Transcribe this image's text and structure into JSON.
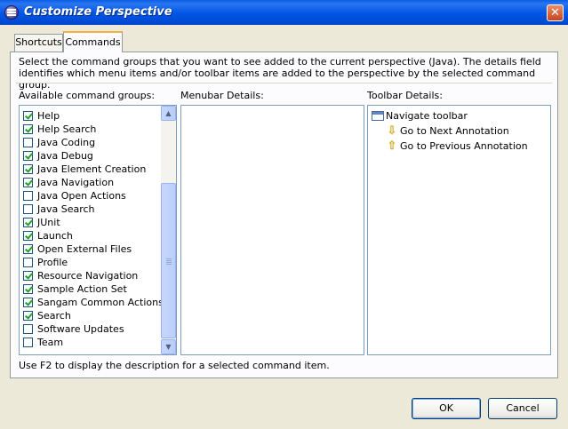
{
  "window": {
    "title": "Customize Perspective",
    "close_glyph": "✕",
    "icon": "eclipse-icon"
  },
  "tabs": [
    {
      "label": "Shortcuts"
    },
    {
      "label": "Commands"
    }
  ],
  "description": "Select the command groups that you want to see added to the current perspective (Java).  The details field identifies which menu items and/or toolbar items are added to the perspective by the selected command group.",
  "labels": {
    "available": "Available command groups:",
    "menubar": "Menubar Details:",
    "toolbar": "Toolbar Details:"
  },
  "command_groups": [
    {
      "label": "Help",
      "checked": true
    },
    {
      "label": "Help Search",
      "checked": true
    },
    {
      "label": "Java Coding",
      "checked": false
    },
    {
      "label": "Java Debug",
      "checked": true
    },
    {
      "label": "Java Element Creation",
      "checked": true
    },
    {
      "label": "Java Navigation",
      "checked": true
    },
    {
      "label": "Java Open Actions",
      "checked": false
    },
    {
      "label": "Java Search",
      "checked": false
    },
    {
      "label": "JUnit",
      "checked": true
    },
    {
      "label": "Launch",
      "checked": true
    },
    {
      "label": "Open External Files",
      "checked": true
    },
    {
      "label": "Profile",
      "checked": false
    },
    {
      "label": "Resource Navigation",
      "checked": true
    },
    {
      "label": "Sample Action Set",
      "checked": true
    },
    {
      "label": "Sangam Common Actions",
      "checked": true
    },
    {
      "label": "Search",
      "checked": true
    },
    {
      "label": "Software Updates",
      "checked": false
    },
    {
      "label": "Team",
      "checked": false
    }
  ],
  "toolbar_details": {
    "root": "Navigate toolbar",
    "children": [
      {
        "label": "Go to Next Annotation",
        "icon": "arrow-down-icon",
        "glyph": "⇩"
      },
      {
        "label": "Go to Previous Annotation",
        "icon": "arrow-up-icon",
        "glyph": "⇧"
      }
    ]
  },
  "status": "Use F2 to display the description for a selected command item.",
  "buttons": {
    "ok": "OK",
    "cancel": "Cancel"
  },
  "scrollbar": {
    "up_glyph": "▲",
    "down_glyph": "▼"
  }
}
